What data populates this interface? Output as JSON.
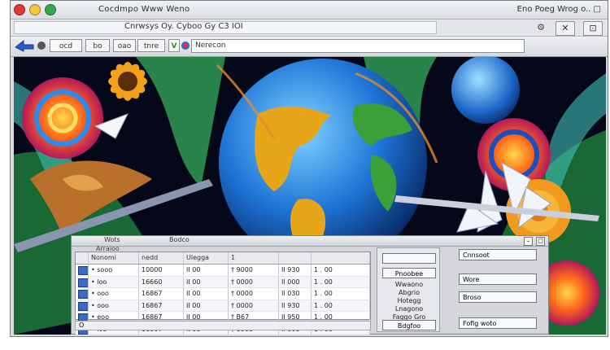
{
  "window": {
    "title": "Cocdmpo Www Weno",
    "title_right": "Eno Poeg Wrog o.. □",
    "traffic_colors": [
      "#e23a3a",
      "#f5c542",
      "#3aa64f"
    ]
  },
  "menubar": {
    "text": "Cnrwsys Oy. Cyboo Gy  C3 IOI",
    "icons": [
      "gear-icon",
      "close-icon",
      "help-icon"
    ]
  },
  "toolbar": {
    "buttons": [
      "ocd",
      "bo",
      "oao",
      "tnre"
    ],
    "address": "Nerecon"
  },
  "panel": {
    "title": "Wots",
    "title2": "Bodco",
    "subtitle": "Arraioo",
    "table": {
      "headers": [
        "",
        "Nonomi",
        "nedd",
        "Ulegga",
        "1",
        ""
      ],
      "rows": [
        {
          "c1": "• sooo",
          "c2": "10000",
          "c3": "II   00",
          "c4": "† 9000",
          "c5": "II 930",
          "c6": "1 . 00"
        },
        {
          "c1": "• loo",
          "c2": "16660",
          "c3": "II   00",
          "c4": "† 0000",
          "c5": "II 000",
          "c6": "1 . 00"
        },
        {
          "c1": "• ooo",
          "c2": "16867",
          "c3": "II   00",
          "c4": "† 0000",
          "c5": "II 030",
          "c6": "1 . 00"
        },
        {
          "c1": "• ooo",
          "c2": "16867",
          "c3": "II   00",
          "c4": "† 0000",
          "c5": "II 930",
          "c6": "1 . 00"
        },
        {
          "c1": "• eoo",
          "c2": "16867",
          "c3": "II   00",
          "c4": "† B67",
          "c5": "II 950",
          "c6": "1 . 00"
        },
        {
          "c1": "• ioo",
          "c2": "16007",
          "c3": "II   00",
          "c4": "† 0000",
          "c5": "II 000",
          "c6": "1 . 00"
        }
      ],
      "footer": "O"
    },
    "mid": {
      "top_button": "",
      "button1": "Pnoobee",
      "labels": [
        "Wwaono",
        "Abgrio",
        "Hotegg",
        "Lnagono",
        "Faggo Gro"
      ],
      "bottom_button": "Bdgfoo"
    },
    "right": {
      "buttons": [
        "Cnnsoot",
        "Wore",
        "Broso",
        "Fofig woto"
      ]
    }
  }
}
